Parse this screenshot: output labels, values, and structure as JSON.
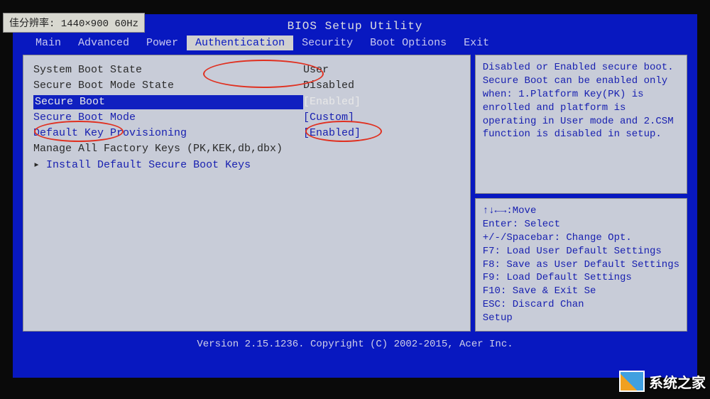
{
  "monitor_overlay": "佳分辨率: 1440×900 60Hz",
  "title": "BIOS Setup Utility",
  "menu": {
    "items": [
      "Main",
      "Advanced",
      "Power",
      "Authentication",
      "Security",
      "Boot Options",
      "Exit"
    ],
    "active_index": 3
  },
  "settings": [
    {
      "label": "System Boot State",
      "value": "User",
      "type": "readonly"
    },
    {
      "label": "Secure Boot Mode State",
      "value": "Disabled",
      "type": "readonly"
    },
    {
      "label": "Secure Boot",
      "value": "[Enabled]",
      "type": "selected"
    },
    {
      "label": "Secure Boot Mode",
      "value": "[Custom]",
      "type": "option"
    },
    {
      "label": "Default Key Provisioning",
      "value": "[Enabled]",
      "type": "option"
    },
    {
      "label": "Manage All Factory Keys (PK,KEK,db,dbx)",
      "value": "",
      "type": "readonly"
    },
    {
      "label": "Install Default Secure Boot Keys",
      "value": "",
      "type": "submenu"
    }
  ],
  "help_text": [
    "Disabled or Enabled secure boot.",
    "Secure Boot can be enabled only when: 1.Platform Key(PK) is enrolled and platform is operating in User mode and 2.CSM function is disabled in setup."
  ],
  "key_help": [
    "↑↓←→:Move",
    "Enter: Select",
    "+/-/Spacebar: Change Opt.",
    "F7: Load User Default Settings",
    "F8: Save as User Default Settings",
    "F9: Load Default Settings",
    "F10: Save & Exit Se",
    "ESC: Discard Chan",
    "Setup"
  ],
  "footer": "Version 2.15.1236. Copyright (C) 2002-2015, Acer Inc.",
  "watermark": "系统之家"
}
